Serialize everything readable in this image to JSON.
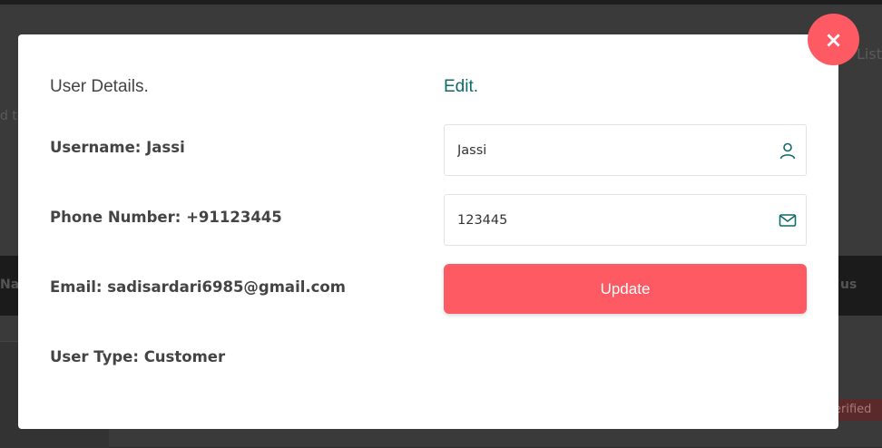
{
  "background": {
    "list_label": "List",
    "left_fragment": "d to",
    "band_left": "Na",
    "band_right": "us",
    "badge": "erified"
  },
  "modal": {
    "close_glyph": "×",
    "details_title": "User Details.",
    "edit_title": "Edit.",
    "details": {
      "username": "Username: Jassi",
      "phone": "Phone Number: +91123445",
      "email": "Email: sadisardari6985@gmail.com",
      "user_type": "User Type: Customer"
    },
    "form": {
      "name_value": "Jassi",
      "name_icon": "user-icon",
      "phone_value": "123445",
      "phone_icon": "envelope-icon",
      "update_label": "Update"
    }
  },
  "colors": {
    "accent": "#fd5a63",
    "teal": "#0f6a6a"
  }
}
